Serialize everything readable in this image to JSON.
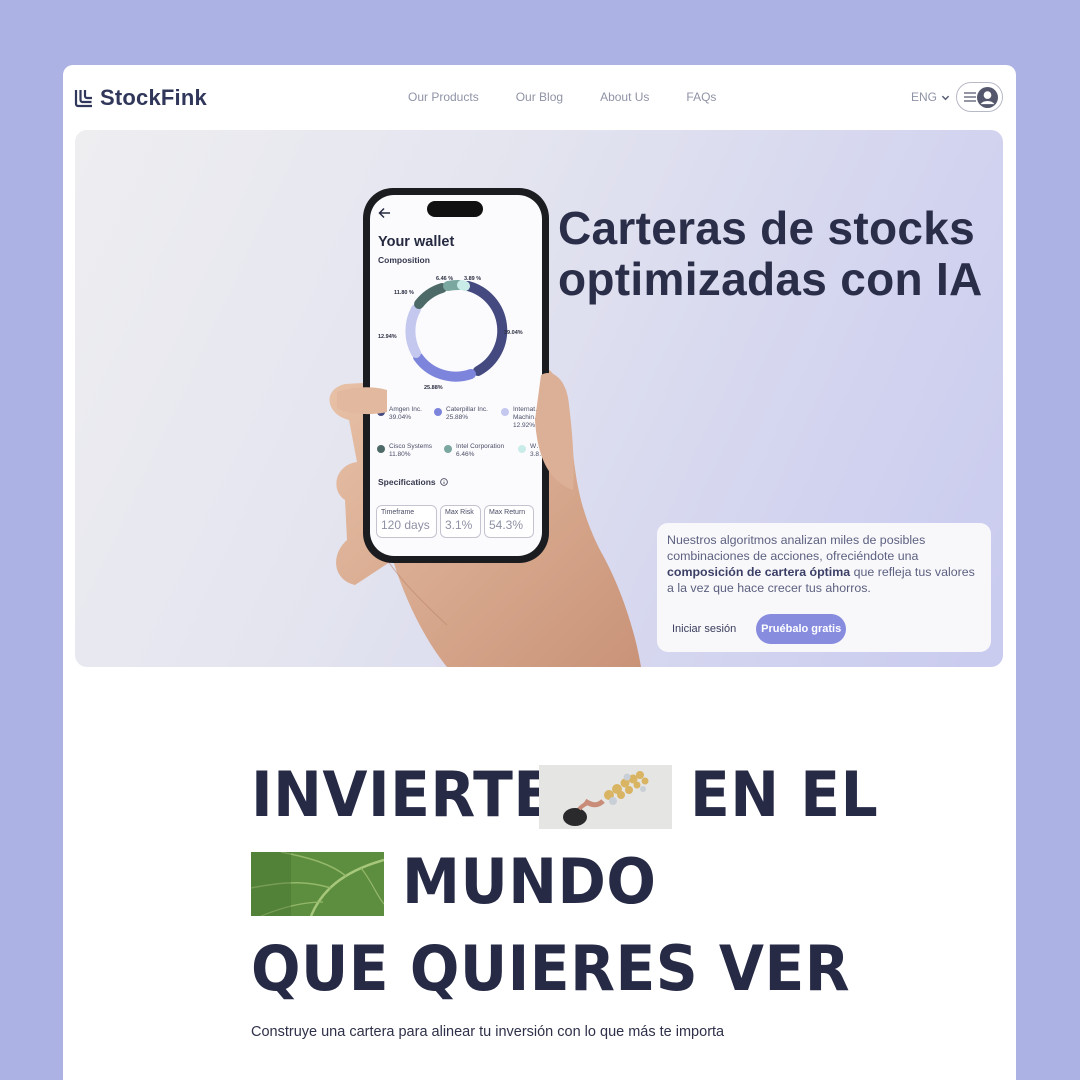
{
  "nav": {
    "brand": "StockFink",
    "links": [
      "Our Products",
      "Our Blog",
      "About Us",
      "FAQs"
    ],
    "language": "ENG",
    "icons": {
      "logo": "stockfink-logo-icon",
      "chevron": "chevron-down-icon",
      "menu": "menu-icon",
      "user": "user-avatar-icon"
    }
  },
  "hero": {
    "title": "Carteras de stocks optimizadas con IA",
    "desc_before": "Nuestros algoritmos analizan miles de posibles combinaciones de acciones, ofreciéndote una ",
    "desc_bold": "composición de cartera óptima",
    "desc_after": " que refleja tus valores a la vez que hace crecer tus ahorros.",
    "login": "Iniciar sesión",
    "try": "Pruébalo gratis"
  },
  "phone": {
    "title": "Your wallet",
    "composition": "Composition",
    "donut_labels": {
      "a": "39.04%",
      "b": "25.88%",
      "c": "12.94%",
      "d": "11.80 %",
      "e": "6.46 %",
      "f": "3.89 %"
    },
    "legend": [
      {
        "name": "Amgen Inc.",
        "pct": "39.04%",
        "color": "#444a80"
      },
      {
        "name": "Caterpillar Inc.",
        "pct": "25.88%",
        "color": "#7d84dc"
      },
      {
        "name": "Internat…",
        "line2": "Machin…",
        "pct": "12.92%",
        "color": "#c4c8ef"
      },
      {
        "name": "Cisco Systems",
        "pct": "11.80%",
        "color": "#4e6a68"
      },
      {
        "name": "Intel Corporation",
        "pct": "6.46%",
        "color": "#7aa7a0"
      },
      {
        "name": "W…",
        "pct": "3.8…",
        "color": "#c9ece8"
      }
    ],
    "specifications": "Specifications",
    "specs": [
      {
        "label": "Timeframe",
        "value": "120 days"
      },
      {
        "label": "Max Risk",
        "value": "3.1%"
      },
      {
        "label": "Max Return",
        "value": "54.3%"
      }
    ]
  },
  "section": {
    "line1a": "INVIERTE",
    "line1b": "EN EL",
    "line2": "MUNDO",
    "line3": "QUE QUIERES VER",
    "subtitle": "Construye una cartera para alinear tu inversión con lo que más te importa"
  }
}
